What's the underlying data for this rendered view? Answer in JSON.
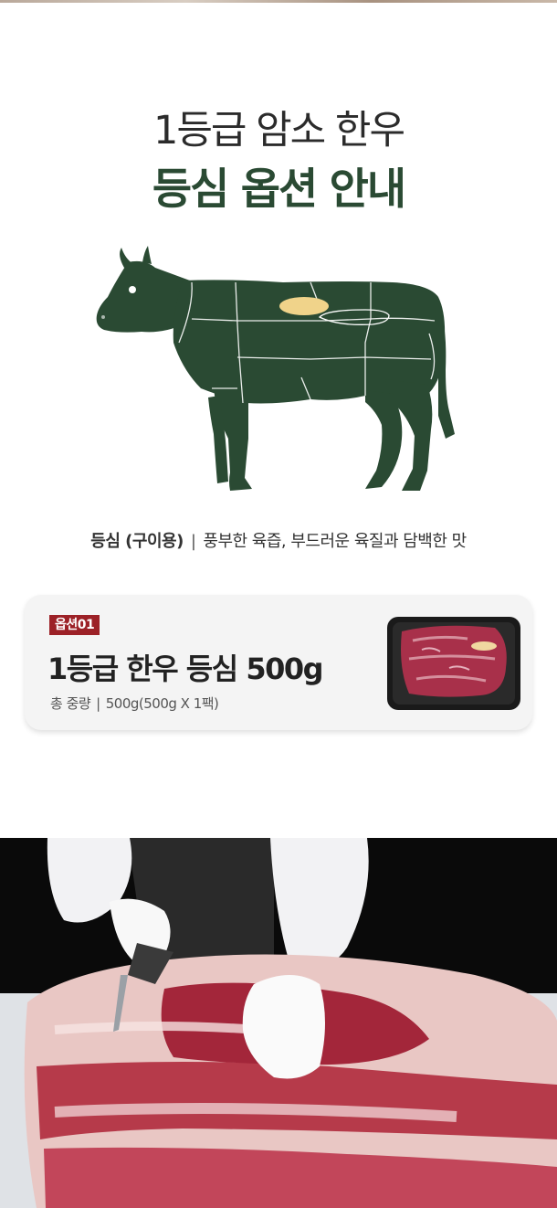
{
  "heading": {
    "line1": "1등급 암소 한우",
    "line2": "등심 옵션 안내"
  },
  "cut": {
    "name": "등심 (구이용)",
    "separator": "|",
    "description": "풍부한 육즙, 부드러운 육질과 담백한 맛"
  },
  "option": {
    "badge": "옵션01",
    "title": "1등급 한우 등심 500g",
    "weight_label": "총 중량",
    "separator": "|",
    "weight_value": "500g(500g X 1팩)"
  },
  "colors": {
    "brand_green": "#2a4a33",
    "badge_red": "#9c2127",
    "highlight": "#f0d38a"
  }
}
